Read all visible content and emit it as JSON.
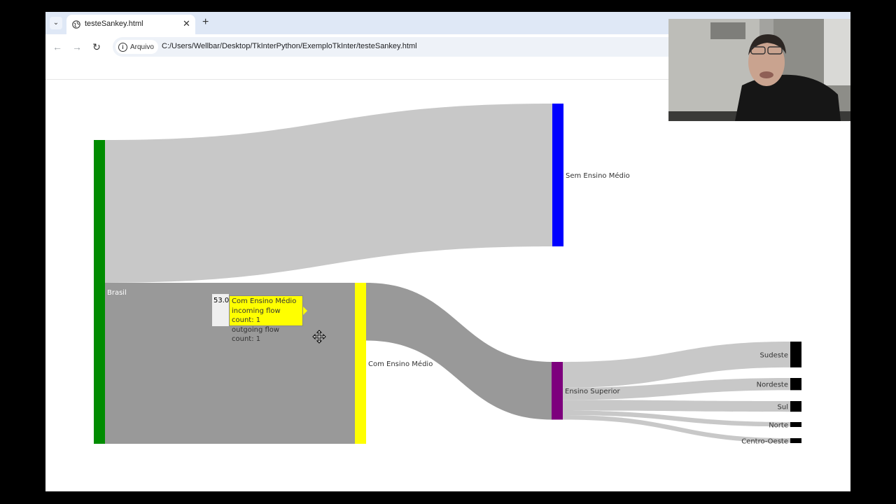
{
  "browser": {
    "tab_title": "testeSankey.html",
    "tab_close_glyph": "✕",
    "new_tab_glyph": "+",
    "tab_list_glyph": "⌄",
    "site_chip_label": "Arquivo",
    "url": "C:/Users/Wellbar/Desktop/TkInterPython/ExemploTkInter/testeSankey.html",
    "back_glyph": "←",
    "forward_glyph": "→",
    "reload_glyph": "↻"
  },
  "sankey": {
    "nodes": [
      {
        "id": "brasil",
        "label": "Brasil",
        "color": "#008c00"
      },
      {
        "id": "sem_ensino_medio",
        "label": "Sem Ensino Médio",
        "color": "#0000ff"
      },
      {
        "id": "com_ensino_medio",
        "label": "Com Ensino Médio",
        "color": "#ffff00"
      },
      {
        "id": "ensino_superior",
        "label": "Ensino Superior",
        "color": "#7d007d"
      },
      {
        "id": "sudeste",
        "label": "Sudeste",
        "color": "#000000"
      },
      {
        "id": "nordeste",
        "label": "Nordeste",
        "color": "#000000"
      },
      {
        "id": "sul",
        "label": "Sul",
        "color": "#000000"
      },
      {
        "id": "norte",
        "label": "Norte",
        "color": "#000000"
      },
      {
        "id": "centro_oeste",
        "label": "Centro-Oeste",
        "color": "#000000"
      }
    ],
    "links": [
      {
        "source": "brasil",
        "target": "sem_ensino_medio",
        "value": 47.0
      },
      {
        "source": "brasil",
        "target": "com_ensino_medio",
        "value": 53.0
      },
      {
        "source": "com_ensino_medio",
        "target": "ensino_superior",
        "value": 19.0
      },
      {
        "source": "ensino_superior",
        "target": "sudeste",
        "value": 8.5
      },
      {
        "source": "ensino_superior",
        "target": "nordeste",
        "value": 4.0
      },
      {
        "source": "ensino_superior",
        "target": "sul",
        "value": 3.5
      },
      {
        "source": "ensino_superior",
        "target": "norte",
        "value": 1.5
      },
      {
        "source": "ensino_superior",
        "target": "centro_oeste",
        "value": 1.5
      }
    ],
    "link_color": "#c8c8c8",
    "link_hover_color": "#999999"
  },
  "tooltip": {
    "value": "53.0",
    "name": "Com Ensino Médio",
    "incoming": "incoming flow count: 1",
    "outgoing": "outgoing flow count: 1",
    "color": "#ffff00"
  }
}
